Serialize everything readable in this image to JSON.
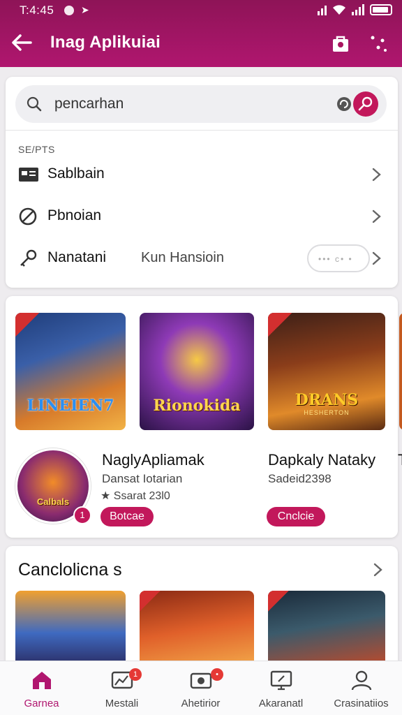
{
  "status_bar": {
    "time": "T:4:45"
  },
  "app_bar": {
    "title": "Inag Aplikuiai"
  },
  "search": {
    "placeholder": "pencarhan"
  },
  "section": {
    "label": "SE/PTS",
    "rows": [
      {
        "label": "Sablbain",
        "icon": "id-card-icon"
      },
      {
        "label": "Pbnoian",
        "icon": "prohibited-icon"
      },
      {
        "label": "Nanatani",
        "sublabel": "Kun Hansioin",
        "pill": "••• c• •",
        "icon": "key-icon"
      }
    ]
  },
  "featured": {
    "tiles": [
      {
        "label": "LINEIEN7",
        "badge": "NEW"
      },
      {
        "label": "Rionokida",
        "badge": ""
      },
      {
        "label": "DRANS",
        "sublabel": "HESHERTON",
        "badge": "NEW"
      }
    ],
    "apps": [
      {
        "title": "NaglyApliamak",
        "subtitle": "Dansat Iotarian",
        "rating": "★ Ssarat 23l0",
        "button": "Botcae",
        "avatar_label": "Calbals",
        "avatar_badge": "1"
      },
      {
        "title": "Dapkaly Nataky",
        "subtitle": "Sadeid2398",
        "button": "Cnclcie"
      }
    ],
    "partial_next": "T"
  },
  "collections": {
    "title": "Canclolicna s",
    "tiles": [
      {
        "badge": ""
      },
      {
        "badge": "NEW"
      },
      {
        "badge": "NEW"
      }
    ]
  },
  "bottom_nav": [
    {
      "label": "Garnea",
      "icon": "home-icon",
      "active": true,
      "badge": ""
    },
    {
      "label": "Mestali",
      "icon": "chart-icon",
      "active": false,
      "badge": "1"
    },
    {
      "label": "Ahetirior",
      "icon": "camera-icon",
      "active": false,
      "badge": "•"
    },
    {
      "label": "Akaranatl",
      "icon": "monitor-icon",
      "active": false,
      "badge": ""
    },
    {
      "label": "Crasinatiios",
      "icon": "person-icon",
      "active": false,
      "badge": ""
    }
  ],
  "colors": {
    "accent": "#b0166f",
    "button": "#c2185b"
  }
}
